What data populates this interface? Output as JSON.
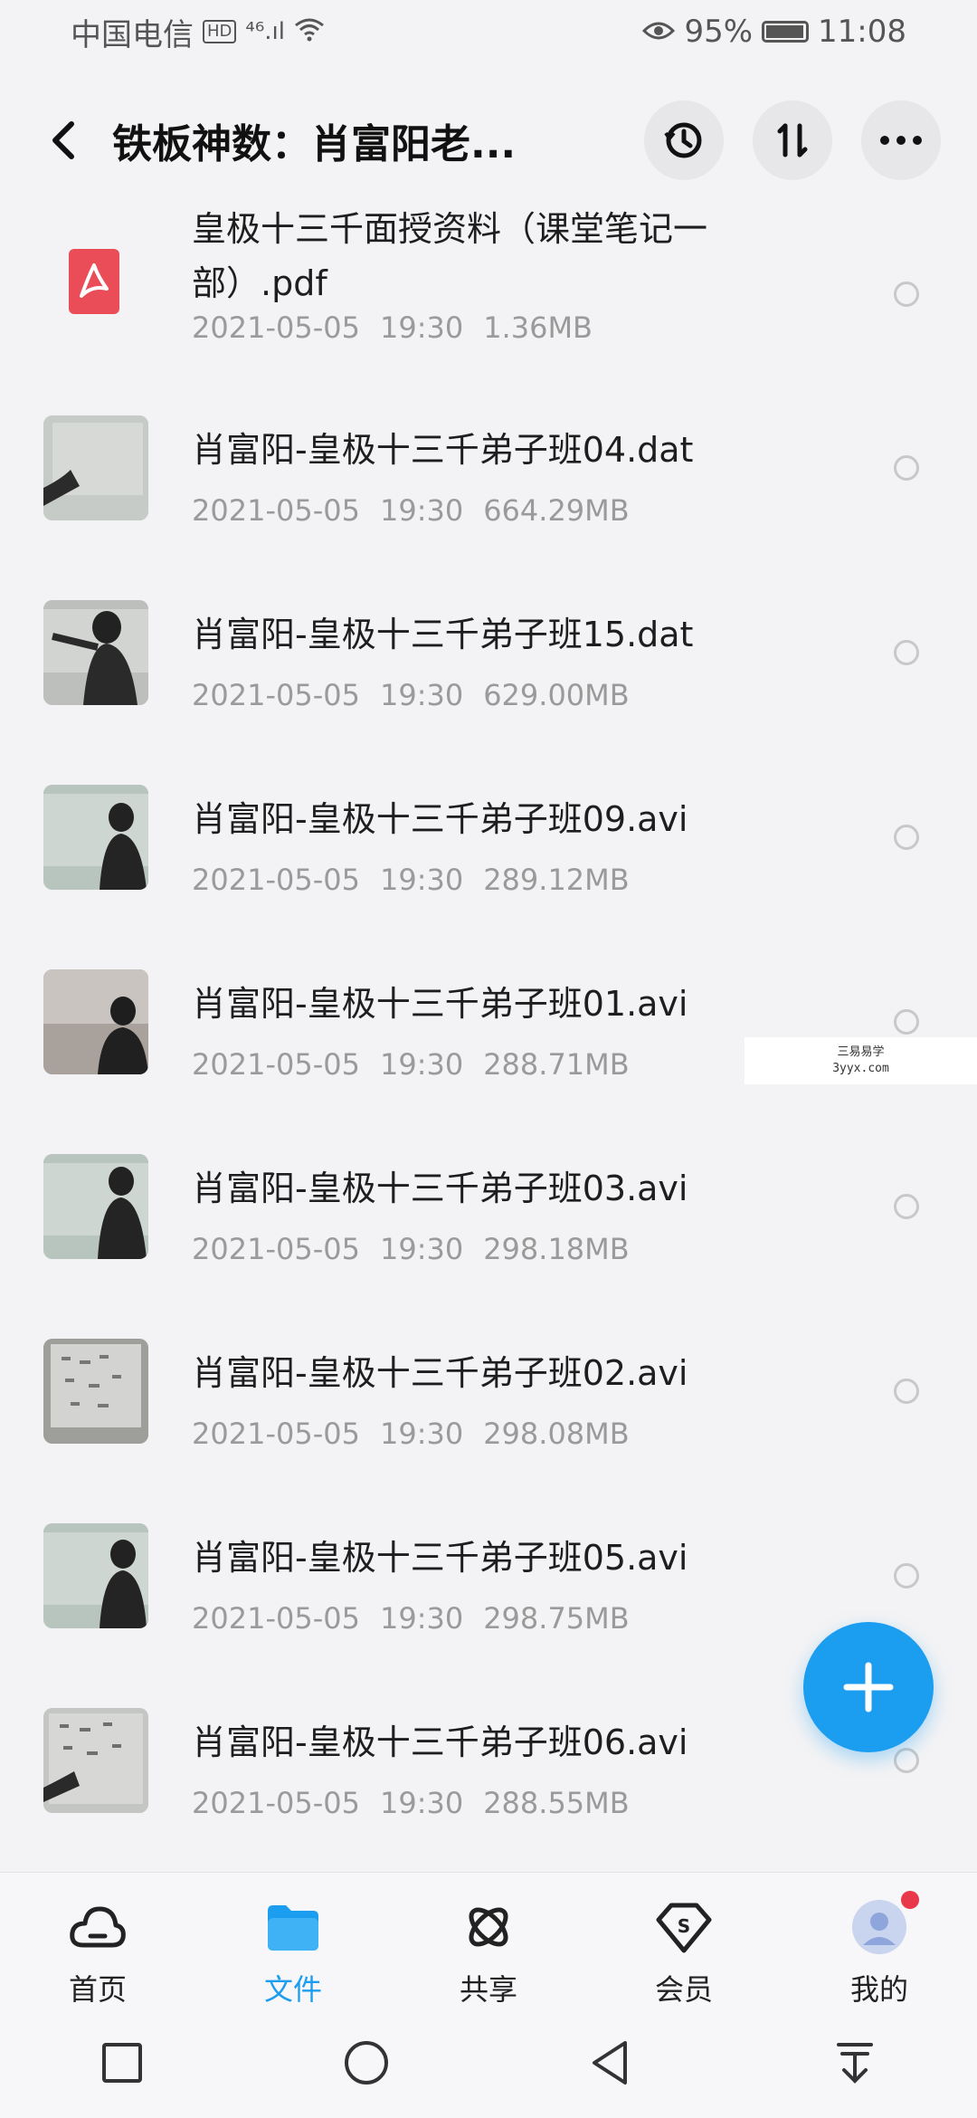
{
  "status_bar": {
    "carrier": "中国电信",
    "hd": "HD",
    "signal": "⁴⁶.ıl",
    "battery_percent": "95%",
    "time": "11:08"
  },
  "header": {
    "title": "铁板神数：肖富阳老..."
  },
  "files": [
    {
      "name": "皇极十三千面授资料（课堂笔记一部）.pdf",
      "date": "2021-05-05",
      "time": "19:30",
      "size": "1.36MB",
      "type": "pdf"
    },
    {
      "name": "肖富阳-皇极十三千弟子班04.dat",
      "date": "2021-05-05",
      "time": "19:30",
      "size": "664.29MB",
      "type": "video"
    },
    {
      "name": "肖富阳-皇极十三千弟子班15.dat",
      "date": "2021-05-05",
      "time": "19:30",
      "size": "629.00MB",
      "type": "video"
    },
    {
      "name": "肖富阳-皇极十三千弟子班09.avi",
      "date": "2021-05-05",
      "time": "19:30",
      "size": "289.12MB",
      "type": "video"
    },
    {
      "name": "肖富阳-皇极十三千弟子班01.avi",
      "date": "2021-05-05",
      "time": "19:30",
      "size": "288.71MB",
      "type": "video"
    },
    {
      "name": "肖富阳-皇极十三千弟子班03.avi",
      "date": "2021-05-05",
      "time": "19:30",
      "size": "298.18MB",
      "type": "video"
    },
    {
      "name": "肖富阳-皇极十三千弟子班02.avi",
      "date": "2021-05-05",
      "time": "19:30",
      "size": "298.08MB",
      "type": "video"
    },
    {
      "name": "肖富阳-皇极十三千弟子班05.avi",
      "date": "2021-05-05",
      "time": "19:30",
      "size": "298.75MB",
      "type": "video"
    },
    {
      "name": "肖富阳-皇极十三千弟子班06.avi",
      "date": "2021-05-05",
      "time": "19:30",
      "size": "288.55MB",
      "type": "video"
    }
  ],
  "watermark": {
    "line1": "三易易学",
    "line2": "3yyx.com"
  },
  "bottom_nav": [
    {
      "label": "首页",
      "icon": "cloud-icon"
    },
    {
      "label": "文件",
      "icon": "folder-icon"
    },
    {
      "label": "共享",
      "icon": "share-icon"
    },
    {
      "label": "会员",
      "icon": "vip-icon"
    },
    {
      "label": "我的",
      "icon": "avatar-icon"
    }
  ],
  "colors": {
    "accent": "#1b9df0",
    "pdf": "#ea4d57",
    "badge": "#e8384a"
  }
}
